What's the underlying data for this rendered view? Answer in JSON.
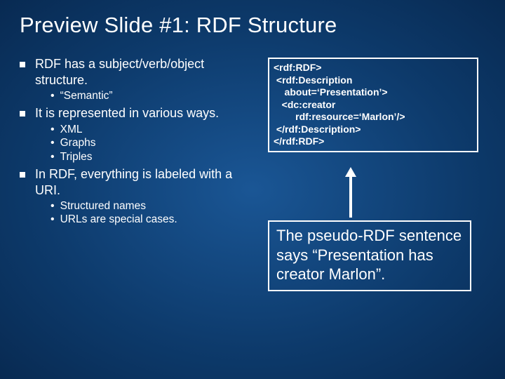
{
  "title": "Preview Slide #1: RDF Structure",
  "bullets": [
    {
      "text": "RDF has a subject/verb/object structure.",
      "subs": [
        "“Semantic”"
      ]
    },
    {
      "text": "It is represented in various ways.",
      "subs": [
        "XML",
        "Graphs",
        "Triples"
      ]
    },
    {
      "text": "In RDF, everything is labeled with a URI.",
      "subs": [
        "Structured names",
        "URLs are special cases."
      ]
    }
  ],
  "code": "<rdf:RDF>\n <rdf:Description\n    about=‘Presentation’>\n   <dc:creator\n        rdf:resource=‘Marlon’/>\n </rdf:Description>\n</rdf:RDF>",
  "caption": "The pseudo-RDF sentence says “Presentation has creator Marlon”."
}
